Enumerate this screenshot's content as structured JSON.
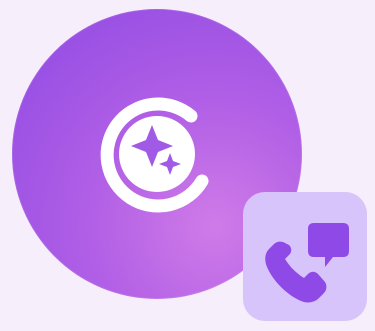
{
  "app_icon": {
    "icon": "sparkle-circle-icon",
    "color": "#a45ae4"
  },
  "badge": {
    "icon": "phone-chat-icon",
    "background": "#d6c4fb",
    "icon_color": "#8f49e7"
  }
}
